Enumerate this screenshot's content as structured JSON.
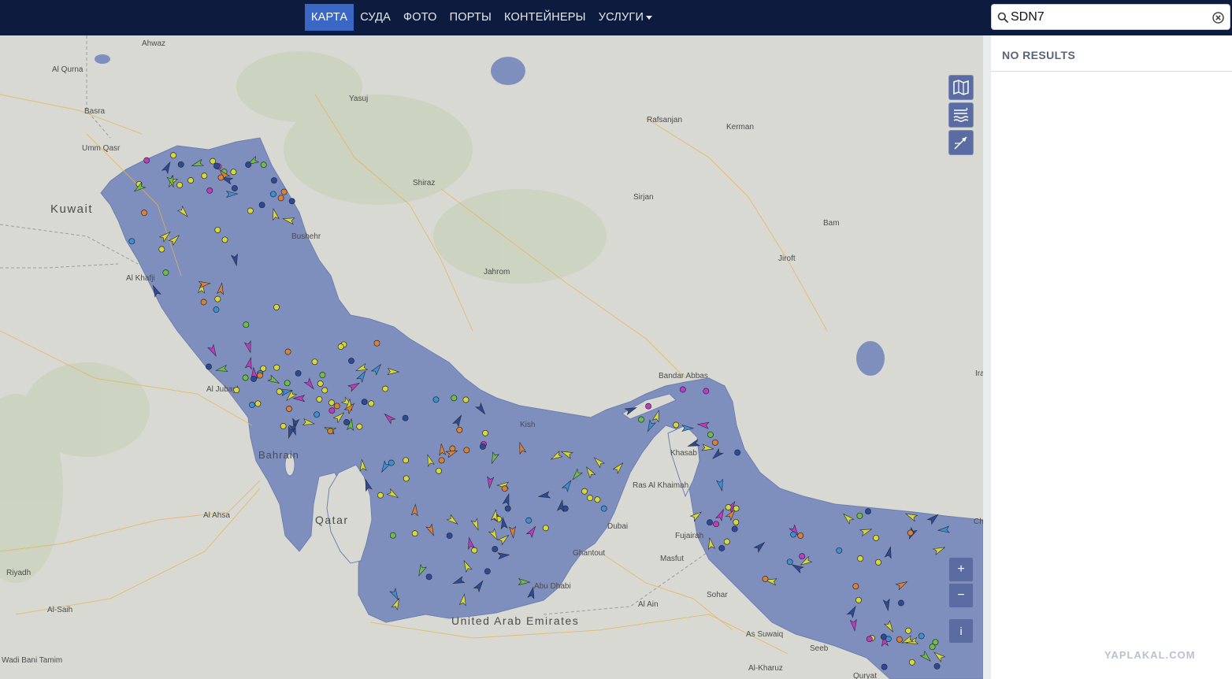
{
  "nav": {
    "items": [
      {
        "label": "КАРТА",
        "active": true
      },
      {
        "label": "СУДА"
      },
      {
        "label": "ФОТО"
      },
      {
        "label": "ПОРТЫ"
      },
      {
        "label": "КОНТЕЙНЕРЫ"
      },
      {
        "label": "УСЛУГИ",
        "has_dropdown": true
      }
    ]
  },
  "search": {
    "value": "SDN7",
    "icon": "search-icon",
    "clear_icon": "clear-icon"
  },
  "results": {
    "empty_text": "NO RESULTS"
  },
  "map_controls": {
    "layers_icon": "map-layers-icon",
    "weather_icon": "wind-waves-icon",
    "tracks_icon": "vessel-tracks-icon",
    "zoom_in": "+",
    "zoom_out": "−",
    "info": "i"
  },
  "map_labels": {
    "ahwaz": "Ahwaz",
    "al_qurna": "Al Qurna",
    "basra": "Basra",
    "umm_qasr": "Umm Qasr",
    "kuwait": "Kuwait",
    "al_khafji": "Al Khafji",
    "yasuj": "Yasuj",
    "shiraz": "Shiraz",
    "bushehr": "Bushehr",
    "jahrom": "Jahrom",
    "rafsanjan": "Rafsanjan",
    "kerman": "Kerman",
    "sirjan": "Sirjan",
    "bam": "Bam",
    "jiroft": "Jiroft",
    "bandar_abbas": "Bandar Abbas",
    "kish": "Kish",
    "khasab": "Khasab",
    "ras_al_khaimah": "Ras Al Khaimah",
    "fujairah": "Fujairah",
    "dubai": "Dubai",
    "ghantout": "Ghantout",
    "abu_dhabi": "Abu Dhabi",
    "masfut": "Masfut",
    "al_ain": "Al Ain",
    "sohar": "Sohar",
    "as_suwaiq": "As Suwaiq",
    "seeb": "Seeb",
    "al_kharuz": "Al-Kharuz",
    "quryat": "Quryat",
    "al_jubayl": "Al Jubayl",
    "bahrain": "Bahrain",
    "qatar": "Qatar",
    "al_ahsa": "Al Ahsa",
    "riyadh": "Riyadh",
    "al_saih": "Al-Saih",
    "wadi_bani_tamim": "Wadi Bani Tamim",
    "uae": "United Arab Emirates",
    "iran_cut": "Ira",
    "ch_cut": "Ch"
  },
  "colors": {
    "water": "#7e8fbd",
    "land": "#d8d8d2",
    "nav_bg": "#0d1b3e",
    "nav_active": "#3a66c4",
    "tanker": "#d6d83a",
    "cargo": "#6ebd4b",
    "passenger": "#3b8fd6",
    "fishing": "#d7813a",
    "special": "#c03bc4",
    "unknown": "#2c4a9b"
  },
  "watermark": "YAPLAKAL.COM"
}
